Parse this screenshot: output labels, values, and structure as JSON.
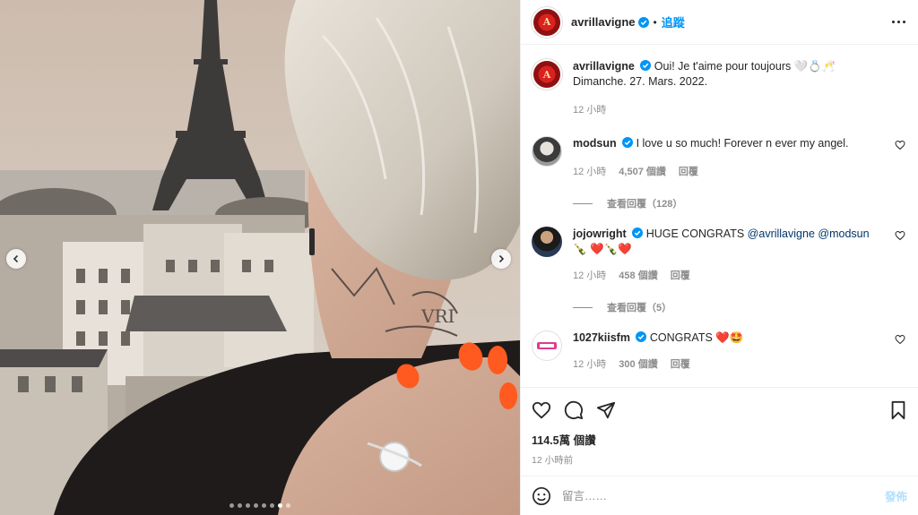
{
  "post": {
    "username": "avrillavigne",
    "separator": "•",
    "follow_label": "追蹤"
  },
  "caption": {
    "username": "avrillavigne",
    "text": "Oui! Je t'aime pour toujours 🤍💍🥂Dimanche. 27. Mars. 2022.",
    "time": "12 小時"
  },
  "comments": [
    {
      "username": "modsun",
      "text": "I love u so much! Forever n ever my angel.",
      "time": "12 小時",
      "likes": "4,507 個讚",
      "reply_label": "回覆",
      "view_replies": "查看回覆（128）"
    },
    {
      "username": "jojowright",
      "text_prefix": "HUGE CONGRATS ",
      "mention1": "@avrillavigne",
      "mention2": "@modsun",
      "text_suffix": " 🍾 ❤️🍾❤️",
      "time": "12 小時",
      "likes": "458 個讚",
      "reply_label": "回覆",
      "view_replies": "查看回覆（5）"
    },
    {
      "username": "1027kiisfm",
      "text": "CONGRATS ❤️🤩",
      "time": "12 小時",
      "likes": "300 個讚",
      "reply_label": "回覆"
    }
  ],
  "stats": {
    "views": "114.5萬 個讚",
    "time_ago": "12 小時前"
  },
  "composer": {
    "placeholder": "留言……",
    "post_label": "發佈"
  },
  "carousel": {
    "total": 8,
    "active": 6
  },
  "icons": {
    "like": "heart-icon",
    "comment": "comment-icon",
    "share": "share-icon",
    "save": "bookmark-icon",
    "emoji": "emoji-icon",
    "verified": "verified-badge-icon",
    "more": "more-options-icon"
  },
  "colors": {
    "accent": "#0095f6",
    "mention": "#00376b",
    "muted": "#8e8e8e",
    "nail": "#ff5a1f"
  }
}
